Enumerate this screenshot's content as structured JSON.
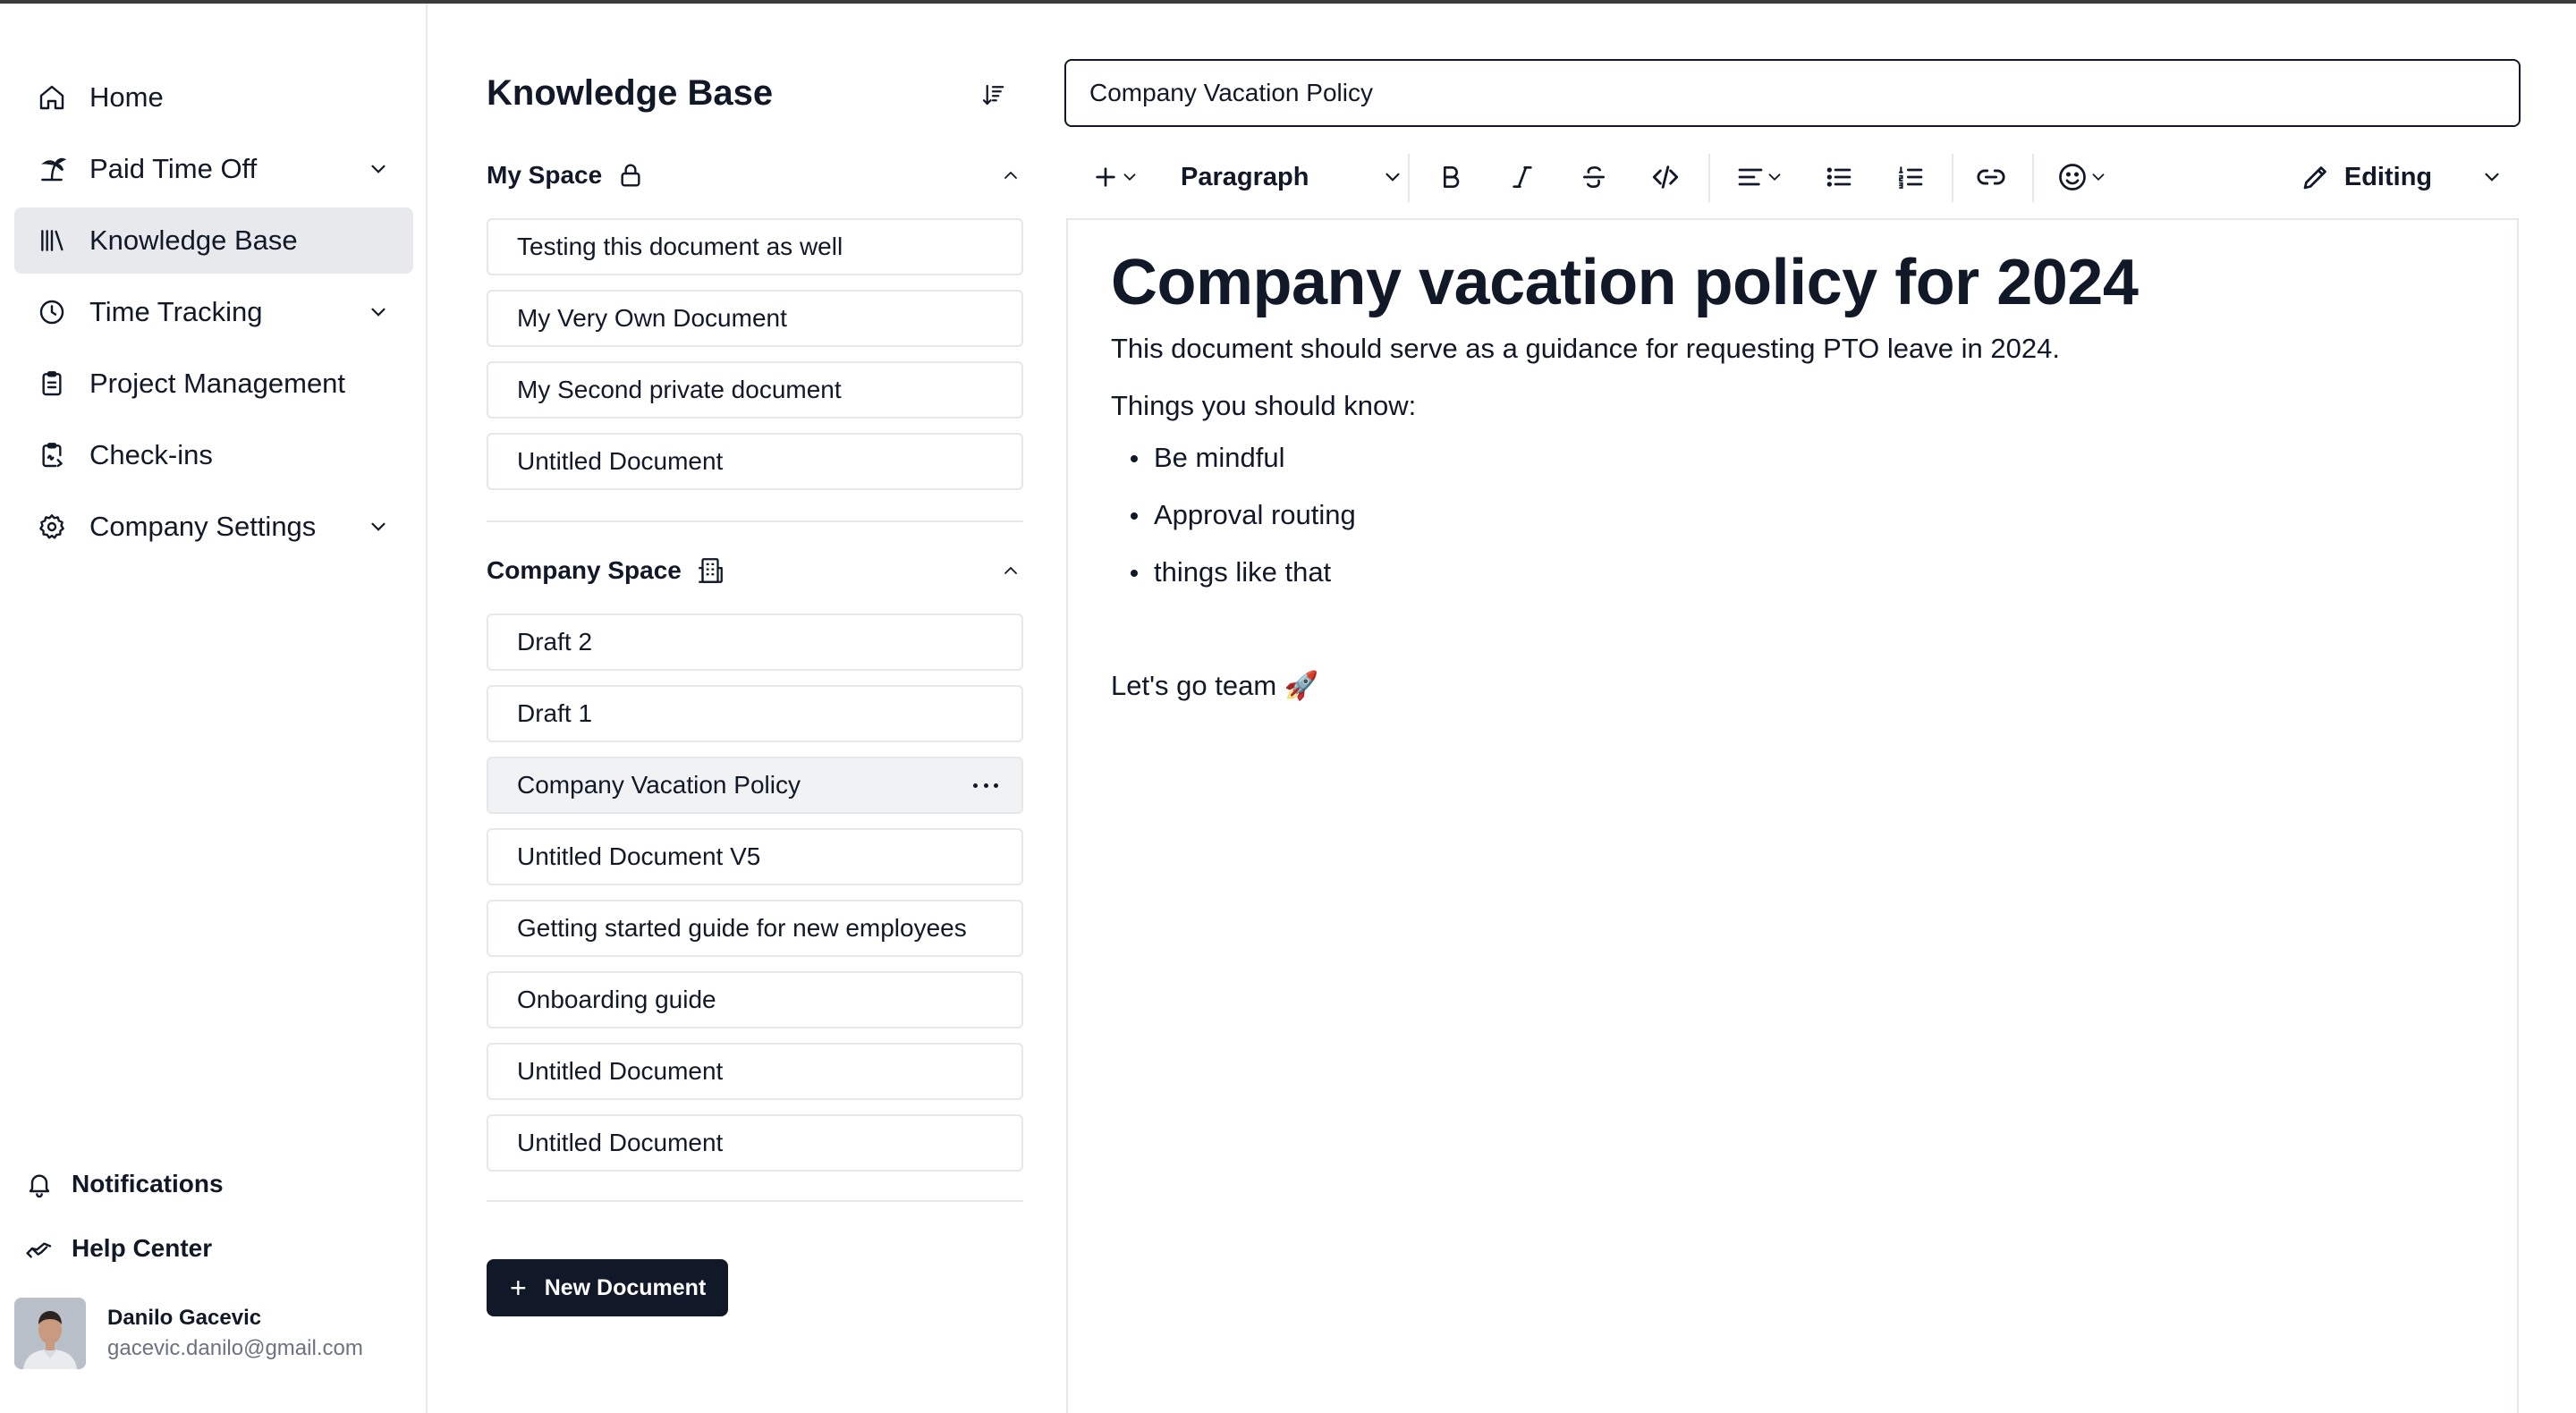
{
  "sidebar": {
    "nav": [
      {
        "label": "Home",
        "icon": "home-icon",
        "has_chevron": false
      },
      {
        "label": "Paid Time Off",
        "icon": "palm-tree-icon",
        "has_chevron": true
      },
      {
        "label": "Knowledge Base",
        "icon": "library-icon",
        "has_chevron": false,
        "active": true
      },
      {
        "label": "Time Tracking",
        "icon": "clock-icon",
        "has_chevron": true
      },
      {
        "label": "Project Management",
        "icon": "clipboard-list-icon",
        "has_chevron": false
      },
      {
        "label": "Check-ins",
        "icon": "clipboard-signature-icon",
        "has_chevron": false
      },
      {
        "label": "Company Settings",
        "icon": "gear-icon",
        "has_chevron": true
      }
    ],
    "footer": {
      "notifications": "Notifications",
      "help_center": "Help Center"
    },
    "user": {
      "name": "Danilo Gacevic",
      "email": "gacevic.danilo@gmail.com"
    }
  },
  "knowledge_base": {
    "title": "Knowledge Base",
    "my_space": {
      "label": "My Space",
      "documents": [
        "Testing this document as well",
        "My Very Own Document",
        "My Second private document",
        "Untitled Document"
      ]
    },
    "company_space": {
      "label": "Company Space",
      "documents": [
        "Draft 2",
        "Draft 1",
        "Company Vacation Policy",
        "Untitled Document V5",
        "Getting started guide for new employees",
        "Onboarding guide",
        "Untitled Document",
        "Untitled Document"
      ],
      "selected_index": 2
    },
    "new_document": "New Document"
  },
  "editor": {
    "title_value": "Company Vacation Policy",
    "toolbar": {
      "block_type": "Paragraph",
      "mode": "Editing"
    },
    "content": {
      "heading": "Company vacation policy for 2024",
      "intro": "This document should serve as a guidance for requesting PTO leave in 2024.",
      "subheading": "Things you should know:",
      "bullets": [
        "Be mindful",
        "Approval routing",
        "things like that"
      ],
      "closing": "Let's go team 🚀"
    }
  },
  "colors": {
    "text": "#111827",
    "muted": "#6b7280",
    "border": "#e5e7eb",
    "active_bg": "#e8e9ec",
    "primary_button": "#111827"
  }
}
